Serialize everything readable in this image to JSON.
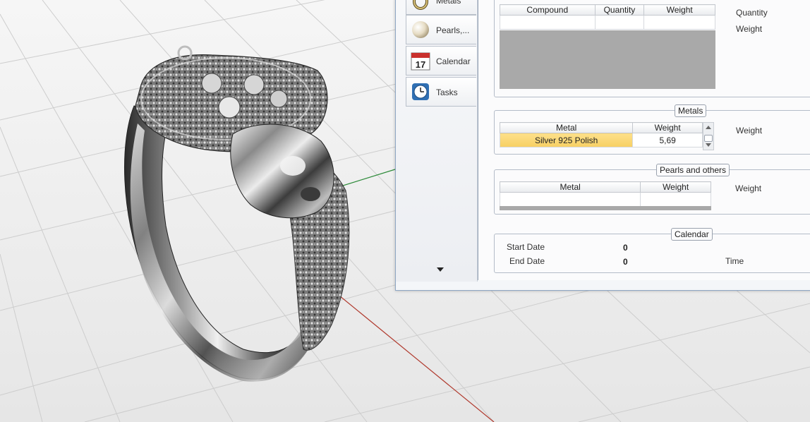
{
  "sidebar": {
    "tabs": [
      {
        "label": "Metals",
        "icon": "ring-icon"
      },
      {
        "label": "Pearls,...",
        "icon": "pearl-icon"
      },
      {
        "label": "Calendar",
        "icon": "calendar-icon",
        "icon_text": "17"
      },
      {
        "label": "Tasks",
        "icon": "clock-icon"
      }
    ]
  },
  "compound": {
    "columns": [
      "Compound",
      "Quantity",
      "Weight"
    ],
    "side_labels": [
      "Quantity",
      "Weight"
    ]
  },
  "metals": {
    "title": "Metals",
    "columns": [
      "Metal",
      "Weight"
    ],
    "rows": [
      {
        "metal": "Silver 925 Polish",
        "weight": "5,69"
      }
    ],
    "side_label": "Weight"
  },
  "pearls": {
    "title": "Pearls and others",
    "columns": [
      "Metal",
      "Weight"
    ],
    "side_label": "Weight"
  },
  "calendar": {
    "title": "Calendar",
    "start_label": "Start Date",
    "start_value": "0",
    "end_label": "End Date",
    "end_value": "0",
    "time_label": "Time"
  },
  "colors": {
    "selected_row": "#f7cf63",
    "axis_x": "#b03a2e",
    "axis_y": "#2e8b3a",
    "panel_border": "#8fa7c4"
  }
}
